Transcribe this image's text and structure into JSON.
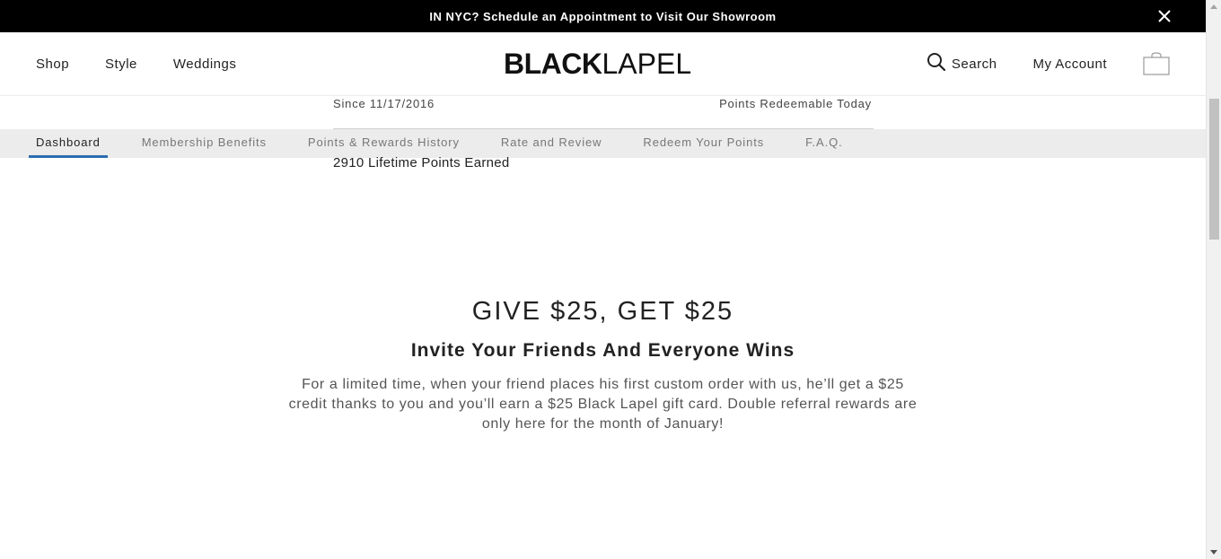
{
  "announcement": {
    "text": "IN NYC? Schedule an Appointment to Visit Our Showroom",
    "close_icon": "close-icon"
  },
  "header": {
    "nav_left": [
      "Shop",
      "Style",
      "Weddings"
    ],
    "logo_bold": "BLACK",
    "logo_light": "LAPEL",
    "search_label": "Search",
    "account_label": "My Account",
    "cart_icon": "shopping-bag-icon"
  },
  "stats": {
    "since": "Since 11/17/2016",
    "redeemable_label": "Points Redeemable Today",
    "lifetime": "2910 Lifetime Points Earned"
  },
  "tabs": [
    {
      "label": "Dashboard",
      "active": true
    },
    {
      "label": "Membership Benefits",
      "active": false
    },
    {
      "label": "Points & Rewards History",
      "active": false
    },
    {
      "label": "Rate and Review",
      "active": false
    },
    {
      "label": "Redeem Your Points",
      "active": false
    },
    {
      "label": "F.A.Q.",
      "active": false
    }
  ],
  "referral": {
    "title": "GIVE $25, GET $25",
    "subtitle": "Invite Your Friends And Everyone Wins",
    "body": "For a limited time, when your friend places his first custom order with us, he’ll get a $25 credit thanks to you and you’ll earn a $25 Black Lapel gift card. Double referral rewards are only here for the month of January!"
  },
  "colors": {
    "announcement_bg": "#000000",
    "tab_bar_bg": "#ececec",
    "active_tab_underline": "#2b6cb0"
  }
}
